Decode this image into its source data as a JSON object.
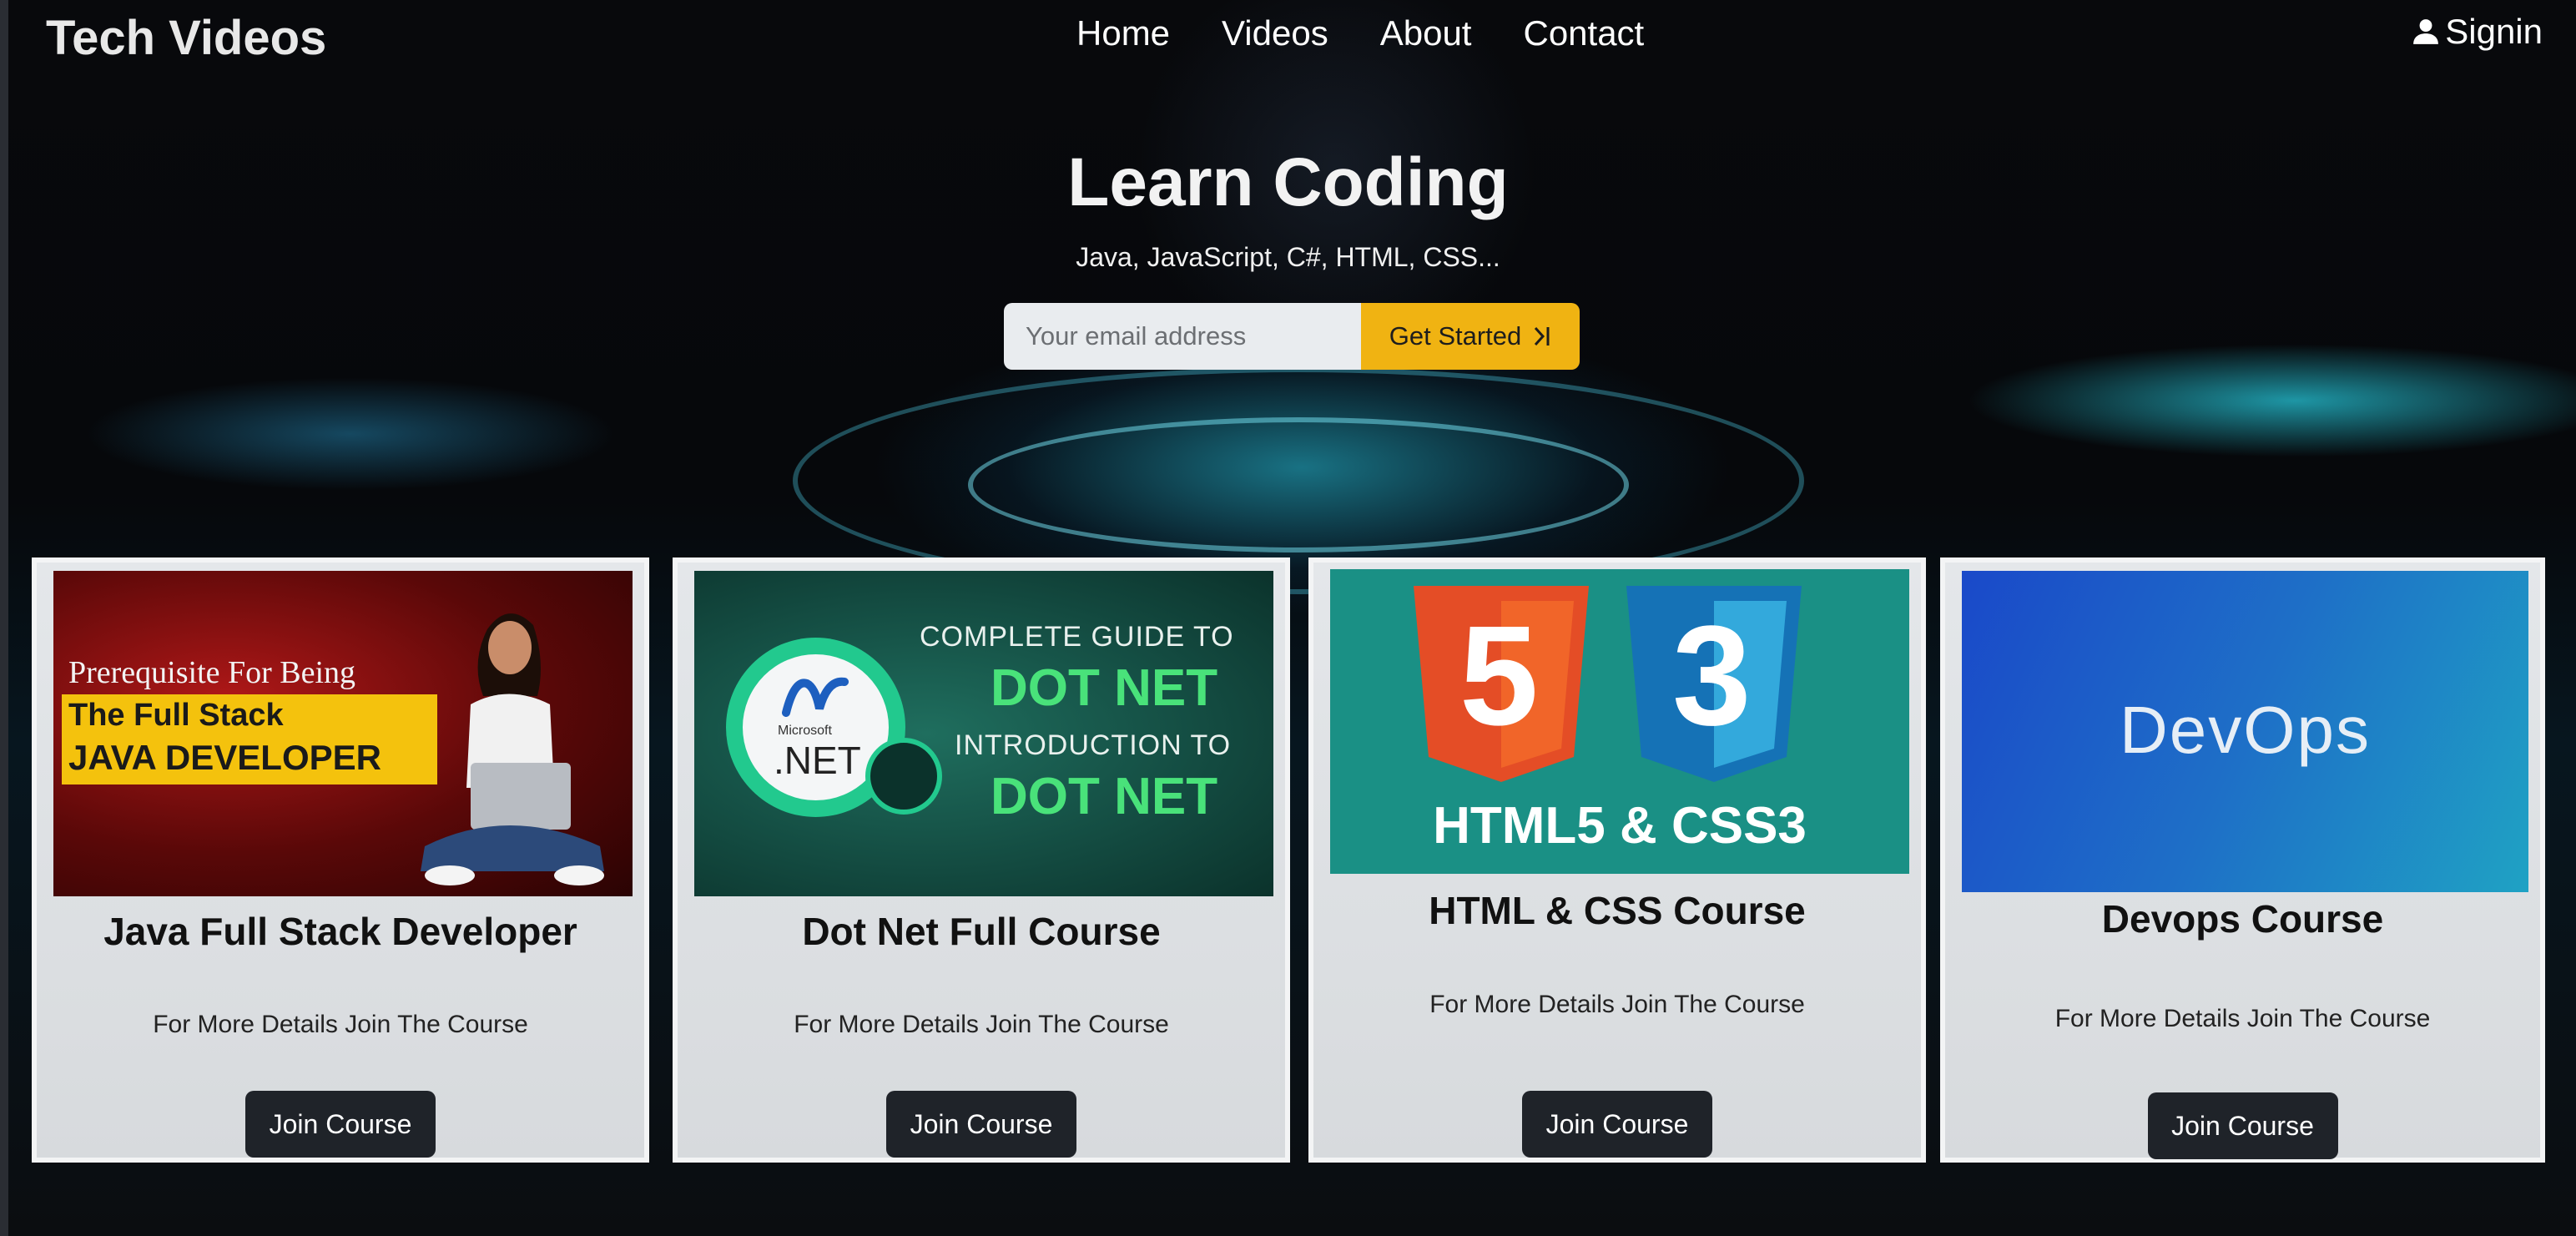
{
  "navbar": {
    "brand": "Tech Videos",
    "links": [
      "Home",
      "Videos",
      "About",
      "Contact"
    ],
    "signin": "Signin"
  },
  "hero": {
    "title": "Learn Coding",
    "subtitle": "Java, JavaScript, C#, HTML, CSS...",
    "email_placeholder": "Your email address",
    "cta_label": "Get Started",
    "cta_icon": "arrow-right-bar-icon"
  },
  "courses": [
    {
      "title": "Java Full Stack Developer",
      "description": "For More Details Join The Course",
      "button": "Join Course",
      "image": {
        "line1": "Prerequisite For Being",
        "line2": "The Full Stack",
        "line3": "JAVA DEVELOPER"
      }
    },
    {
      "title": "Dot Net Full Course",
      "description": "For More Details Join The Course",
      "button": "Join Course",
      "image": {
        "line1": "COMPLETE GUIDE TO",
        "line2": "DOT NET",
        "line3": "INTRODUCTION TO",
        "line4": "DOT NET",
        "logo_small": "Microsoft",
        "logo_main": ".NET"
      }
    },
    {
      "title": "HTML & CSS Course",
      "description": "For More Details Join The Course",
      "button": "Join Course",
      "image": {
        "html_digit": "5",
        "css_digit": "3",
        "caption": "HTML5 & CSS3"
      }
    },
    {
      "title": "Devops Course",
      "description": "For More Details Join The Course",
      "button": "Join Course",
      "image": {
        "caption": "DevOps"
      }
    }
  ],
  "colors": {
    "cta": "#f0b312",
    "button_dark": "#1f2329",
    "card_bg": "#e4e7ea",
    "teal_accent": "#28d2e6"
  }
}
